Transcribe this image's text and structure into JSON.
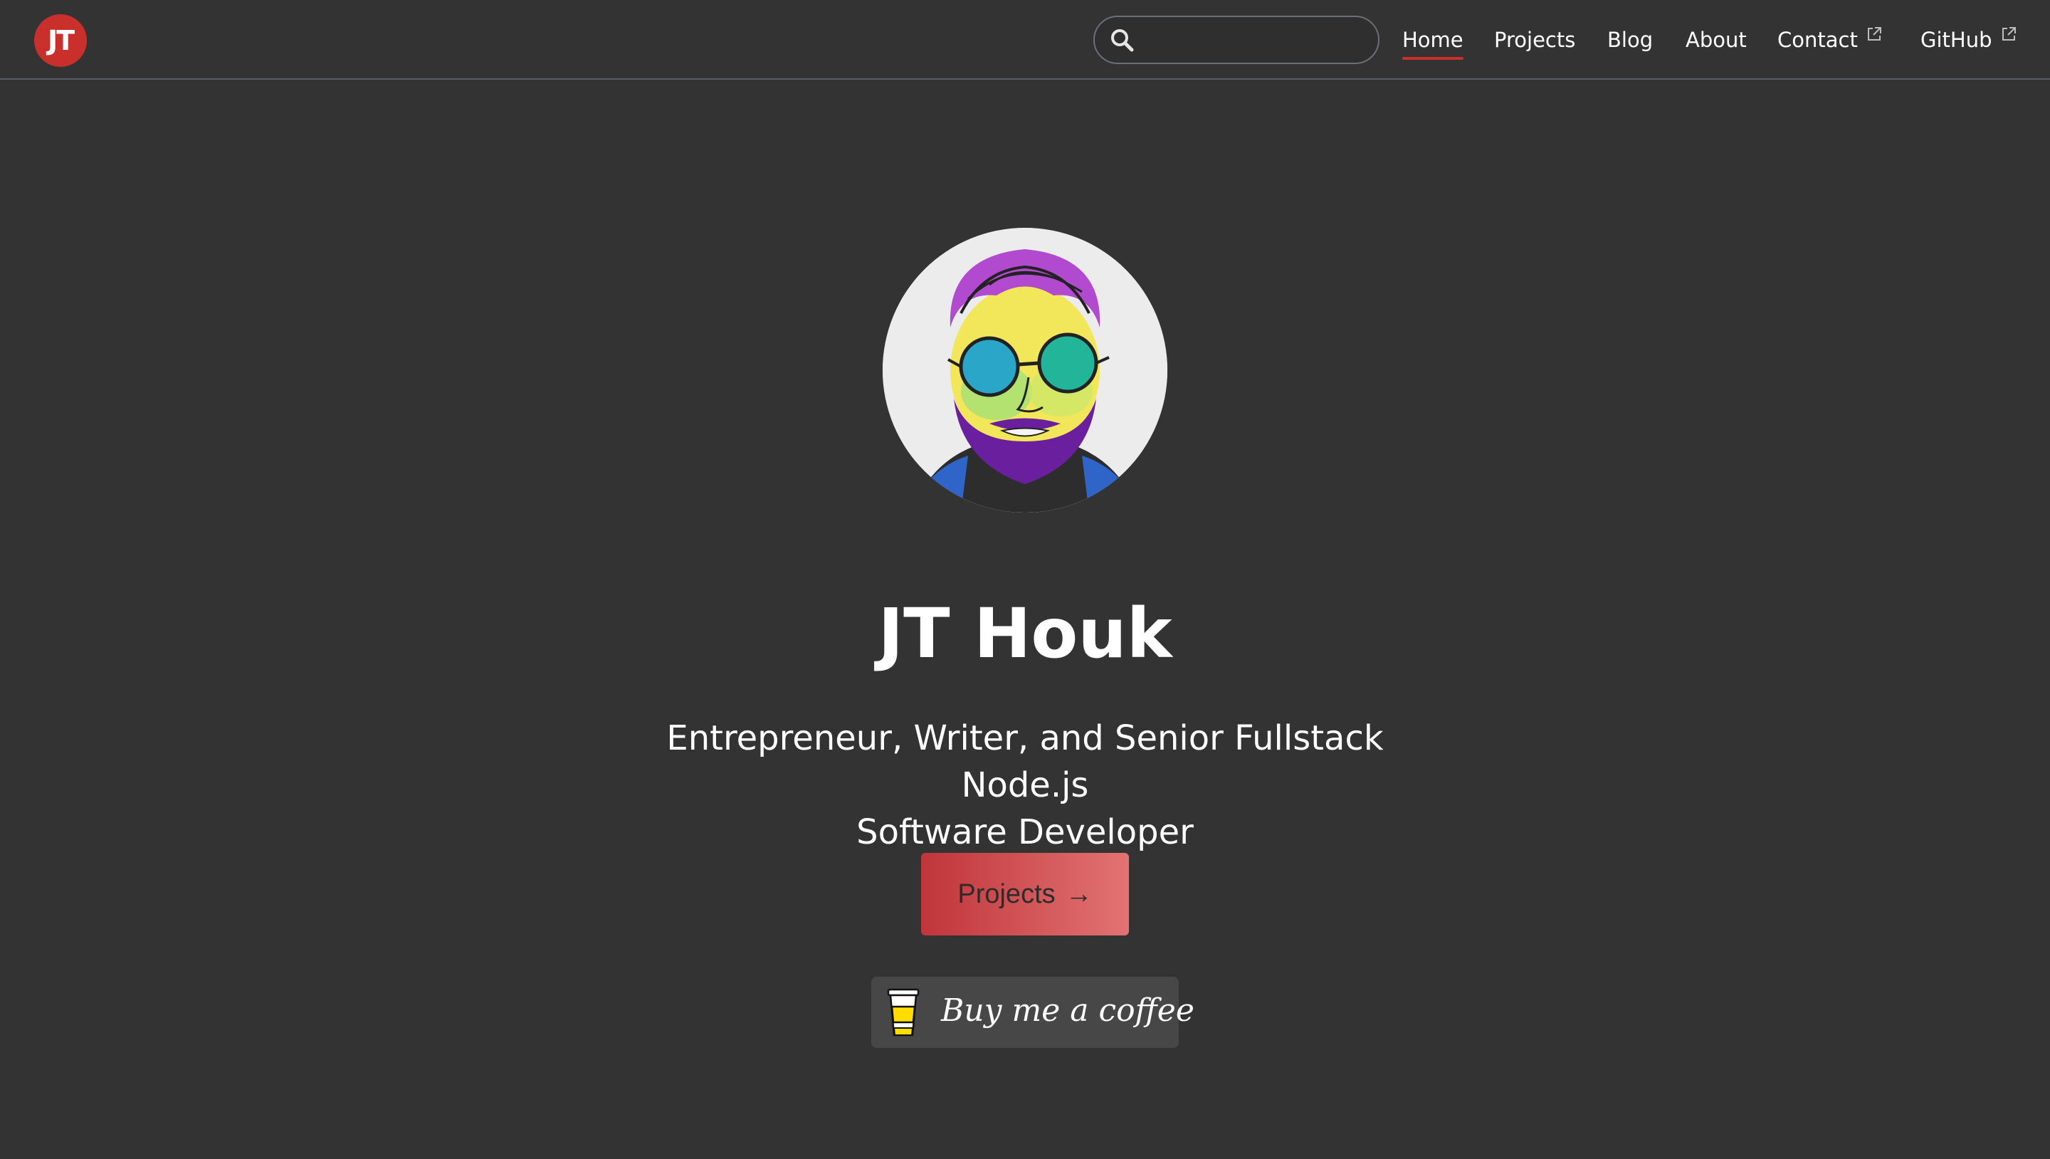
{
  "header": {
    "logo_text": "JT",
    "search": {
      "placeholder": "",
      "value": ""
    },
    "nav": {
      "home": "Home",
      "projects": "Projects",
      "blog": "Blog",
      "about": "About",
      "contact": "Contact",
      "github": "GitHub"
    },
    "active_item": "Home"
  },
  "hero": {
    "name": "JT Houk",
    "subtitle_line1": "Entrepreneur, Writer, and Senior Fullstack Node.js",
    "subtitle_line2": "Software Developer",
    "projects_button": "Projects",
    "projects_arrow": "→",
    "coffee_button": "Buy me a coffee"
  },
  "colors": {
    "background": "#333333",
    "accent": "#c9302c",
    "coffee_button_bg": "#474747"
  },
  "icons": [
    "search-icon",
    "external-link-icon",
    "arrow-right-icon",
    "coffee-cup-icon"
  ]
}
